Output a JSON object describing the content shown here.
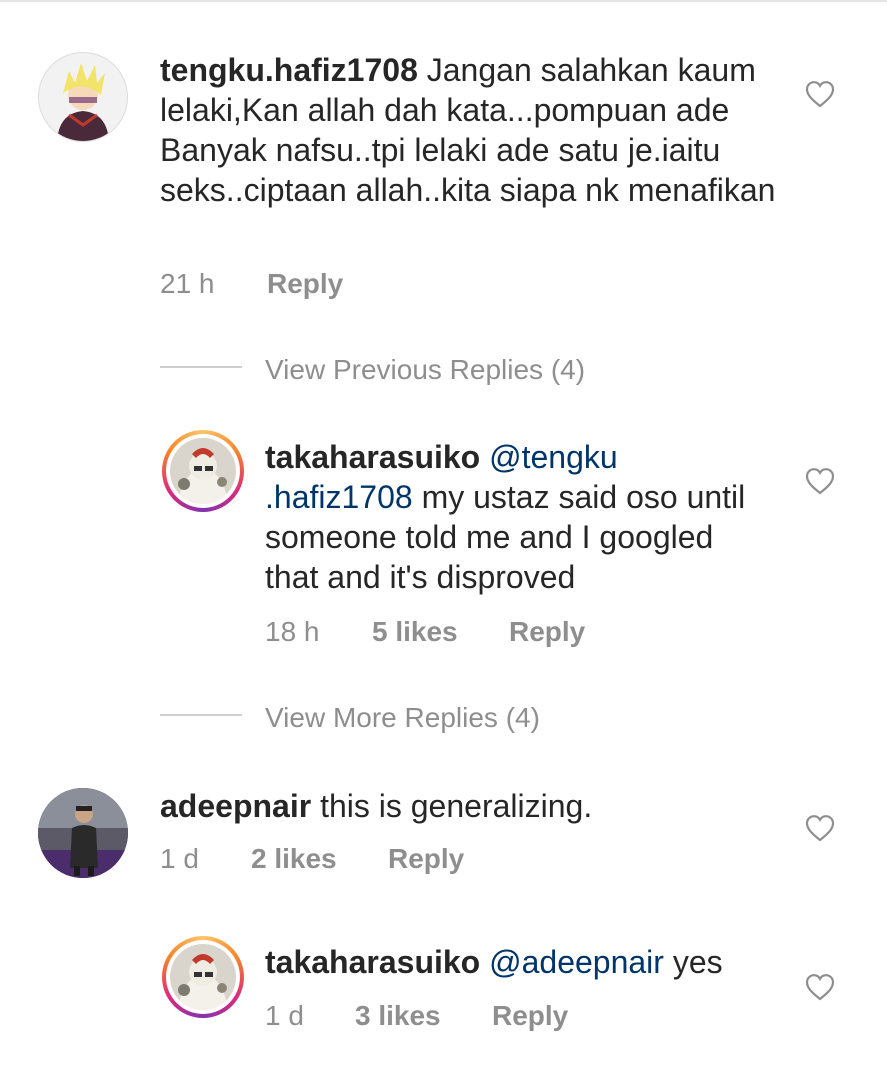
{
  "comments": [
    {
      "username": "tengku.hafiz1708",
      "text": "Jangan salahkan kaum lelaki,Kan allah dah kata...pompuan ade Banyak nafsu..tpi lelaki ade satu je.iaitu seks..ciptaan allah..kita siapa nk menafikan",
      "time": "21 h",
      "reply_label": "Reply",
      "avatar": "blonde-anime-character-avatar",
      "like_icon": "heart-outline-icon"
    },
    {
      "username": "takaharasuiko",
      "mention": "@tengku .hafiz1708",
      "text": "my ustaz said oso until someone told me and I googled that and it's disproved",
      "time": "18 h",
      "likes": "5 likes",
      "reply_label": "Reply",
      "avatar": "story-ring-avatar",
      "like_icon": "heart-outline-icon"
    },
    {
      "username": "adeepnair",
      "text": "this is generalizing.",
      "time": "1 d",
      "likes": "2 likes",
      "reply_label": "Reply",
      "avatar": "person-photo-avatar",
      "like_icon": "heart-outline-icon"
    },
    {
      "username": "takaharasuiko",
      "mention": "@adeepnair",
      "text": "yes",
      "time": "1 d",
      "likes": "3 likes",
      "reply_label": "Reply",
      "avatar": "story-ring-avatar",
      "like_icon": "heart-outline-icon"
    }
  ],
  "view_previous_replies": "View Previous Replies (4)",
  "view_more_replies": "View More Replies (4)",
  "colors": {
    "text": "#262626",
    "muted": "#8e8e8e",
    "mention": "#003569"
  }
}
